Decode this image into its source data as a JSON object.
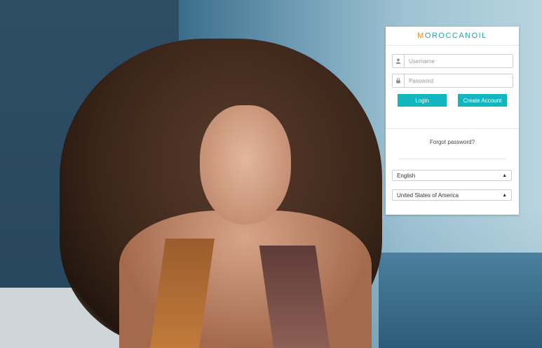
{
  "brand": {
    "logo_text_first": "M",
    "logo_text_rest": "OROCCANOIL"
  },
  "login": {
    "username_placeholder": "Username",
    "password_placeholder": "Password",
    "login_label": "Login",
    "create_account_label": "Create Account",
    "forgot_label": "Forgot password?"
  },
  "selectors": {
    "language": "English",
    "country": "United States of America"
  },
  "icons": {
    "username": "user-icon",
    "password": "lock-icon",
    "select": "updown-caret-icon"
  },
  "colors": {
    "accent": "#11b6bf",
    "logo_m": "#f08c1a",
    "logo_text": "#19a9b3"
  }
}
